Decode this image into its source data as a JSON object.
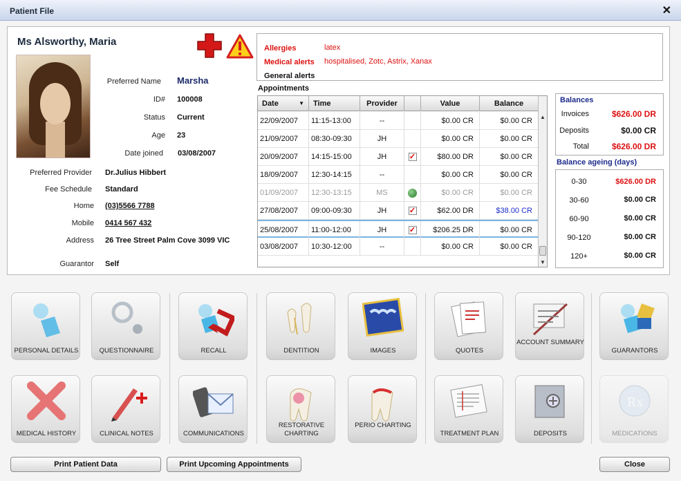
{
  "window": {
    "title": "Patient File",
    "close_glyph": "✕"
  },
  "patient": {
    "name": "Ms Alsworthy, Maria",
    "fields": [
      {
        "label": "Preferred Name",
        "value": "Marsha"
      },
      {
        "label": "ID#",
        "value": "100008"
      },
      {
        "label": "Status",
        "value": "Current"
      },
      {
        "label": "Age",
        "value": "23"
      },
      {
        "label": "Date joined",
        "value": "03/08/2007"
      }
    ],
    "details": [
      {
        "label": "Preferred Provider",
        "value": "Dr.Julius Hibbert"
      },
      {
        "label": "Fee Schedule",
        "value": "Standard"
      },
      {
        "label": "Home",
        "value": "(03)5566 7788"
      },
      {
        "label": "Mobile",
        "value": "0414 567 432"
      },
      {
        "label": "Address",
        "value": "26 Tree Street Palm Cove 3099 VIC"
      },
      {
        "label": "Guarantor",
        "value": "Self"
      }
    ]
  },
  "alerts": {
    "allergies_label": "Allergies",
    "allergies_value": "latex",
    "medical_label": "Medical alerts",
    "medical_value": "hospitalised, Zotc, Astrix, Xanax",
    "general_label": "General alerts",
    "colors": {
      "alert": "#dd1111"
    }
  },
  "appointments": {
    "heading": "Appointments",
    "columns": [
      "Date",
      "Time",
      "Provider",
      "",
      "Value",
      "Balance"
    ],
    "sort_glyph": "▼",
    "rows": [
      {
        "date": "22/09/2007",
        "time": "11:15-13:00",
        "provider": "--",
        "mark": "",
        "value": "$0.00 CR",
        "balance": "$0.00 CR"
      },
      {
        "date": "21/09/2007",
        "time": "08:30-09:30",
        "provider": "JH",
        "mark": "",
        "value": "$0.00 CR",
        "balance": "$0.00 CR"
      },
      {
        "date": "20/09/2007",
        "time": "14:15-15:00",
        "provider": "JH",
        "mark": "check",
        "value": "$80.00 DR",
        "balance": "$0.00 CR"
      },
      {
        "date": "18/09/2007",
        "time": "12:30-14:15",
        "provider": "--",
        "mark": "",
        "value": "$0.00 CR",
        "balance": "$0.00 CR"
      },
      {
        "date": "01/09/2007",
        "time": "12:30-13:15",
        "provider": "MS",
        "mark": "green-circle",
        "value": "$0.00 CR",
        "balance": "$0.00 CR"
      },
      {
        "date": "27/08/2007",
        "time": "09:00-09:30",
        "provider": "JH",
        "mark": "check",
        "value": "$62.00 DR",
        "balance": "$38.00 CR"
      },
      {
        "date": "25/08/2007",
        "time": "11:00-12:00",
        "provider": "JH",
        "mark": "check",
        "value": "$206.25 DR",
        "balance": "$0.00 CR"
      },
      {
        "date": "03/08/2007",
        "time": "10:30-12:00",
        "provider": "--",
        "mark": "",
        "value": "$0.00 CR",
        "balance": "$0.00 CR"
      }
    ]
  },
  "balances": {
    "title": "Balances",
    "items": [
      {
        "label": "Invoices",
        "value": "$626.00 DR",
        "color": "#dd1111"
      },
      {
        "label": "Deposits",
        "value": "$0.00 CR",
        "color": "#111111"
      },
      {
        "label": "Total",
        "value": "$626.00 DR",
        "color": "#dd1111"
      }
    ]
  },
  "ageing": {
    "title": "Balance ageing (days)",
    "items": [
      {
        "label": "0-30",
        "value": "$626.00 DR",
        "color": "#dd1111"
      },
      {
        "label": "30-60",
        "value": "$0.00 CR",
        "color": "#111111"
      },
      {
        "label": "60-90",
        "value": "$0.00 CR",
        "color": "#111111"
      },
      {
        "label": "90-120",
        "value": "$0.00 CR",
        "color": "#111111"
      },
      {
        "label": "120+",
        "value": "$0.00 CR",
        "color": "#111111"
      }
    ]
  },
  "tiles": {
    "row1": [
      {
        "label": "PERSONAL DETAILS",
        "icon": "person-icon"
      },
      {
        "label": "QUESTIONNAIRE",
        "icon": "question-icon"
      },
      {
        "label": "RECALL",
        "icon": "recall-icon"
      },
      {
        "label": "DENTITION",
        "icon": "teeth-icon"
      },
      {
        "label": "IMAGES",
        "icon": "xray-icon"
      },
      {
        "label": "QUOTES",
        "icon": "quote-doc-icon"
      },
      {
        "label": "ACCOUNT SUMMARY",
        "icon": "account-icon"
      },
      {
        "label": "GUARANTORS",
        "icon": "guarantor-icon"
      }
    ],
    "row2": [
      {
        "label": "MEDICAL HISTORY",
        "icon": "medical-cross-icon"
      },
      {
        "label": "CLINICAL NOTES",
        "icon": "pencil-plus-icon"
      },
      {
        "label": "COMMUNICATIONS",
        "icon": "phone-mail-icon"
      },
      {
        "label": "RESTORATIVE CHARTING",
        "icon": "restorative-tooth-icon"
      },
      {
        "label": "PERIO CHARTING",
        "icon": "perio-tooth-icon"
      },
      {
        "label": "TREATMENT PLAN",
        "icon": "plan-sheet-icon"
      },
      {
        "label": "DEPOSITS",
        "icon": "safe-icon"
      },
      {
        "label": "MEDICATIONS",
        "icon": "rx-icon"
      }
    ]
  },
  "buttons": {
    "print_patient": "Print Patient Data",
    "print_appts": "Print Upcoming Appointments",
    "close": "Close"
  }
}
